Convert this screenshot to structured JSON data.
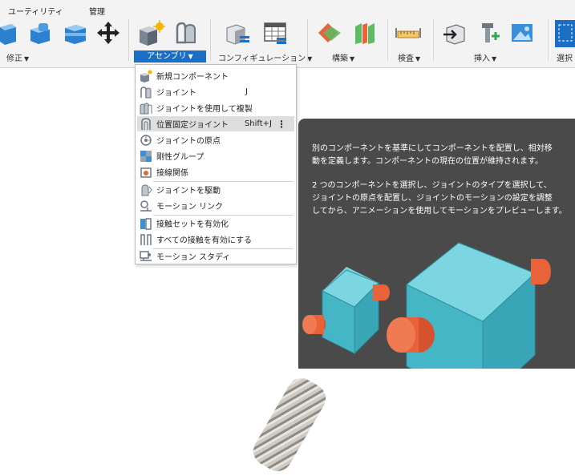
{
  "ribbon": {
    "tabs": [
      "ユーティリティ",
      "管理"
    ],
    "groups": {
      "modify": "修正",
      "assemble": "アセンブリ",
      "configure": "コンフィギュレーション",
      "construct": "構築",
      "inspect": "検査",
      "insert": "挿入",
      "select": "選択"
    }
  },
  "menu": {
    "items": [
      {
        "label": "新規コンポーネント",
        "shortcut": "",
        "icon": "new-component-icon"
      },
      {
        "label": "ジョイント",
        "shortcut": "J",
        "icon": "joint-icon"
      },
      {
        "label": "ジョイントを使用して複製",
        "shortcut": "",
        "icon": "duplicate-with-joints-icon"
      },
      {
        "label": "位置固定ジョイント",
        "shortcut": "Shift+J",
        "icon": "as-built-joint-icon",
        "highlighted": true
      },
      {
        "label": "ジョイントの原点",
        "shortcut": "",
        "icon": "joint-origin-icon"
      },
      {
        "label": "剛性グループ",
        "shortcut": "",
        "icon": "rigid-group-icon"
      },
      {
        "label": "接線関係",
        "shortcut": "",
        "icon": "tangent-relationship-icon"
      },
      {
        "label": "ジョイントを駆動",
        "shortcut": "",
        "icon": "drive-joints-icon"
      },
      {
        "label": "モーション リンク",
        "shortcut": "",
        "icon": "motion-link-icon"
      },
      {
        "label": "接触セットを有効化",
        "shortcut": "",
        "icon": "enable-contact-sets-icon"
      },
      {
        "label": "すべての接触を有効にする",
        "shortcut": "",
        "icon": "enable-all-contact-icon"
      },
      {
        "label": "モーション スタディ",
        "shortcut": "",
        "icon": "motion-study-icon"
      }
    ]
  },
  "tooltip": {
    "para1": [
      "別のコンポーネントを基準にしてコンポーネントを配置し、相対移",
      "動を定義します。コンポーネントの現在の位置が維持されます。"
    ],
    "para2": [
      "2 つのコンポーネントを選択し、ジョイントのタイプを選択して、",
      "ジョイントの原点を配置し、ジョイントのモーションの設定を調整",
      "してから、アニメーションを使用してモーションをプレビューします。"
    ]
  },
  "colors": {
    "accent": "#1a6fc4",
    "tooltip_bg": "#4a4a4a",
    "cube": "#4fc3d3",
    "cylinder": "#e8623a"
  }
}
